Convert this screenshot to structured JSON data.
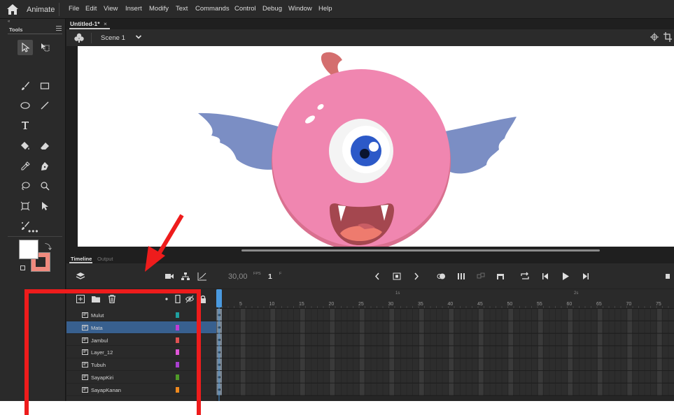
{
  "app": {
    "name": "Animate"
  },
  "menu": [
    "File",
    "Edit",
    "View",
    "Insert",
    "Modify",
    "Text",
    "Commands",
    "Control",
    "Debug",
    "Window",
    "Help"
  ],
  "tools_panel": {
    "title": "Tools",
    "collapse_glyph": "«",
    "more_glyph": "•••",
    "tools": [
      "selection-icon",
      "free-transform-icon",
      "brush-icon",
      "rectangle-icon",
      "oval-icon",
      "line-icon",
      "text-icon",
      "paint-bucket-icon",
      "eraser-icon",
      "eyedropper-icon",
      "pen-icon",
      "lasso-icon",
      "zoom-icon",
      "camera-icon",
      "subselection-icon",
      "fluid-brush-icon"
    ],
    "fill_color": "#ffffff",
    "stroke_color": "#f08a7e"
  },
  "document": {
    "tab_title": "Untitled-1*",
    "close_glyph": "×"
  },
  "scene": {
    "label": "Scene 1"
  },
  "colors": {
    "character_body": "#f086b0",
    "wings": "#7b8ec4",
    "tuft": "#d46e6e",
    "mouth": "#a4474f"
  },
  "timeline": {
    "tab_timeline": "Timeline",
    "tab_output": "Output",
    "fps": "30,00",
    "fps_unit": "FPS",
    "current_frame": "1",
    "frame_unit": "F",
    "ruler_numbers": [
      "5",
      "10",
      "15",
      "20",
      "25",
      "30",
      "35",
      "40",
      "45",
      "50",
      "55",
      "60",
      "65",
      "70",
      "75"
    ],
    "ruler_seconds": [
      "1s",
      "2s"
    ],
    "layers": [
      {
        "name": "Mulut",
        "color": "#1fa0a0",
        "selected": false
      },
      {
        "name": "Mata",
        "color": "#c23cd6",
        "selected": true
      },
      {
        "name": "Jambul",
        "color": "#e05252",
        "selected": false
      },
      {
        "name": "Layer_12",
        "color": "#e056d8",
        "selected": false
      },
      {
        "name": "Tubuh",
        "color": "#a93fd0",
        "selected": false
      },
      {
        "name": "SayapKiri",
        "color": "#4f9a28",
        "selected": false
      },
      {
        "name": "SayapKanan",
        "color": "#f08a1e",
        "selected": false
      }
    ]
  }
}
